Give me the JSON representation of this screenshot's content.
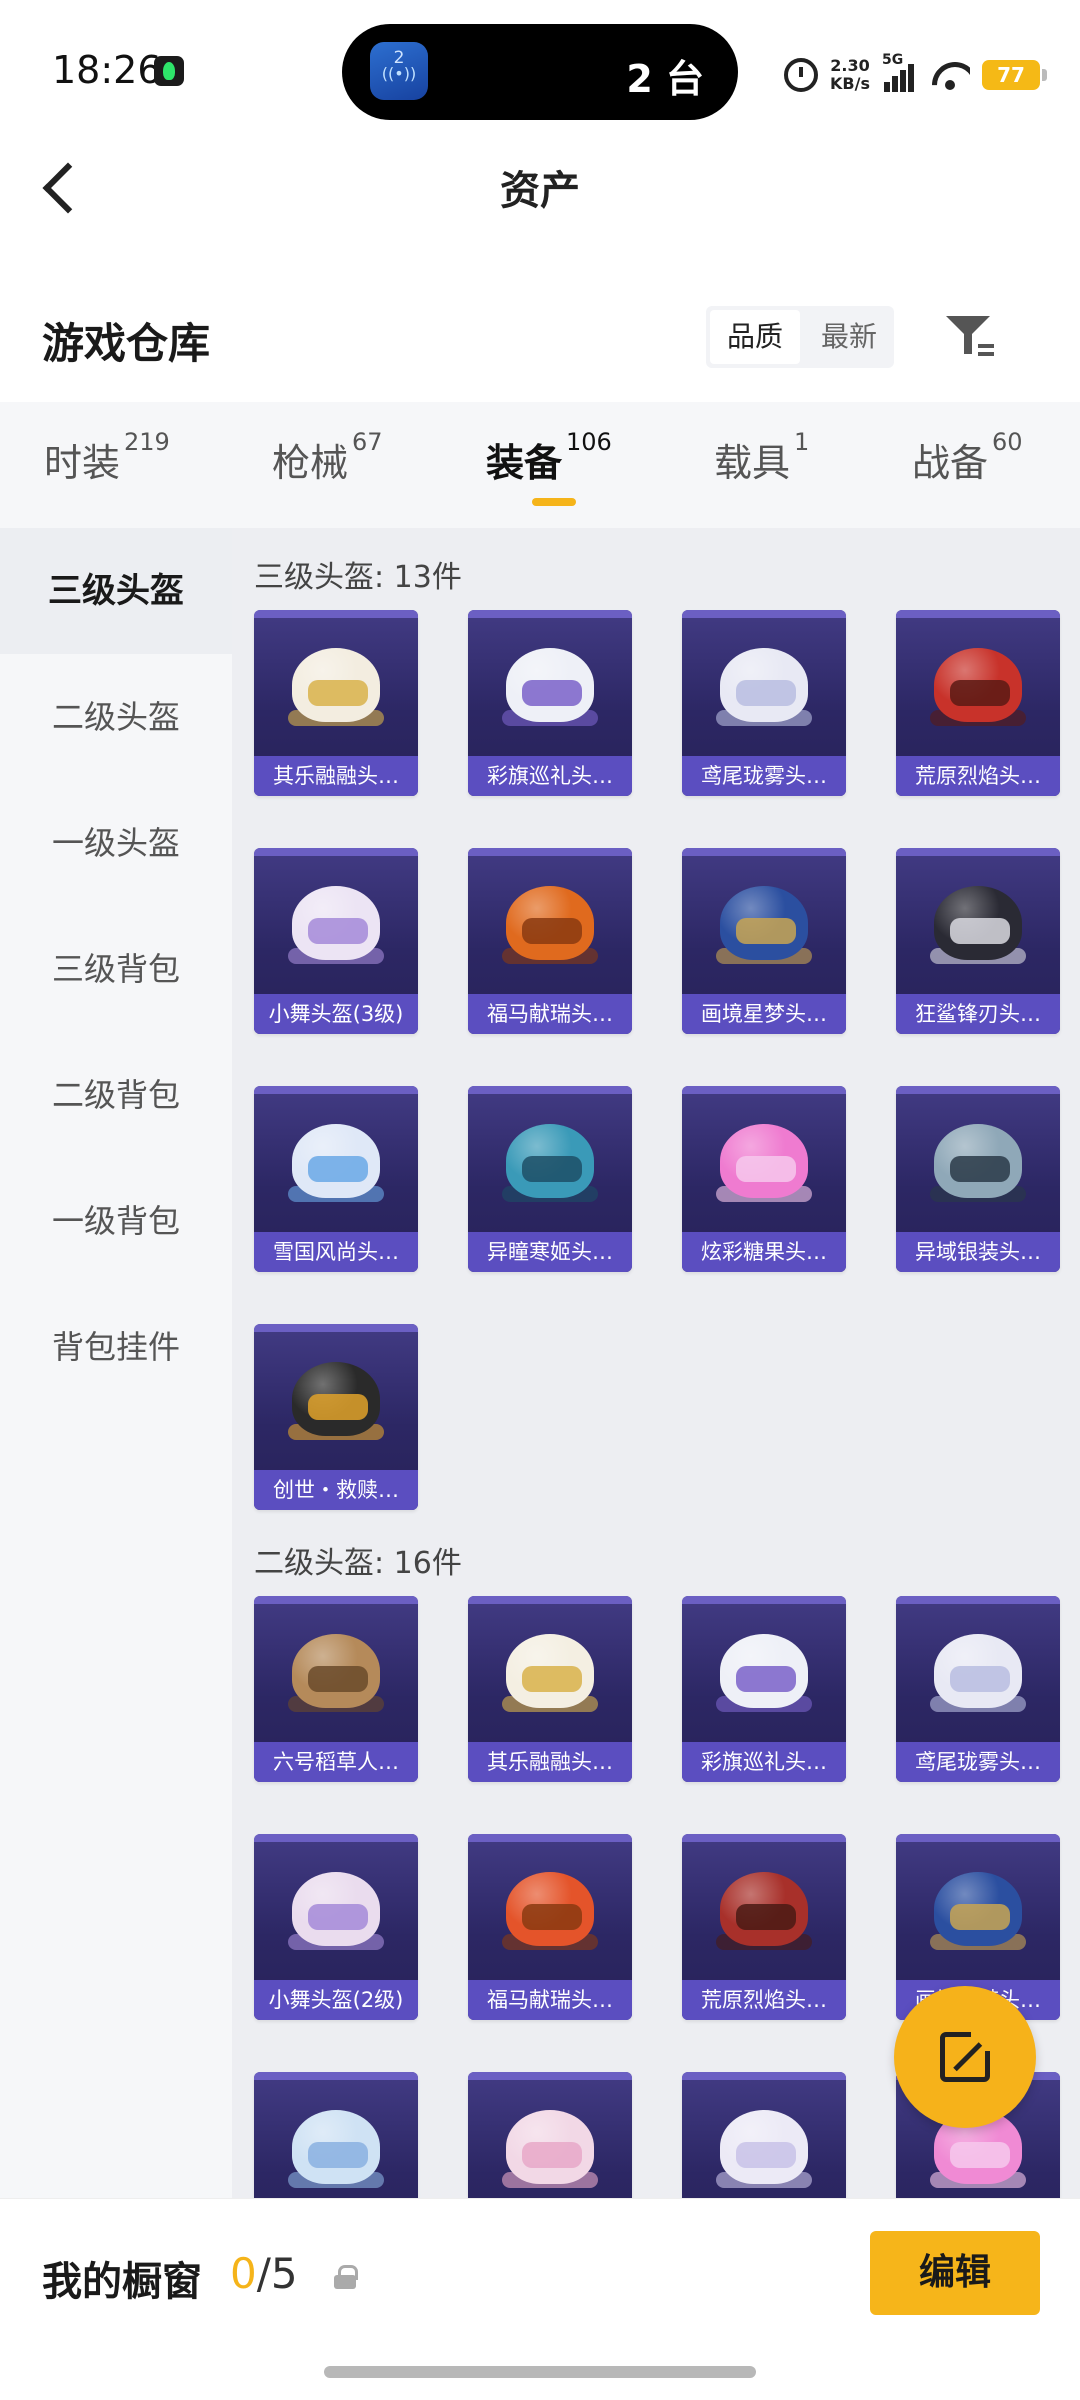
{
  "status_bar": {
    "time": "18:26",
    "island_badge": "2",
    "island_text": "2 台",
    "net_speed_value": "2.30",
    "net_speed_unit": "KB/s",
    "network_type": "5G",
    "battery": "77"
  },
  "header": {
    "title": "资产"
  },
  "section": {
    "title": "游戏仓库",
    "sort_options": [
      "品质",
      "最新"
    ],
    "sort_selected": "品质"
  },
  "tabs": [
    {
      "label": "时装",
      "count": "219"
    },
    {
      "label": "枪械",
      "count": "67"
    },
    {
      "label": "装备",
      "count": "106"
    },
    {
      "label": "载具",
      "count": "1"
    },
    {
      "label": "战备",
      "count": "60"
    }
  ],
  "active_tab": "装备",
  "sidebar": {
    "items": [
      "三级头盔",
      "二级头盔",
      "一级头盔",
      "三级背包",
      "二级背包",
      "一级背包",
      "背包挂件"
    ]
  },
  "groups": [
    {
      "title": "三级头盔: 13件",
      "items": [
        {
          "label": "其乐融融头…",
          "color": "#f3ede0",
          "accent": "#d8b24a"
        },
        {
          "label": "彩旗巡礼头…",
          "color": "#eef0f7",
          "accent": "#7a62c9"
        },
        {
          "label": "鸢尾珑雾头…",
          "color": "#e8e9f4",
          "accent": "#b8bde0"
        },
        {
          "label": "荒原烈焰头…",
          "color": "#c8322a",
          "accent": "#5a1a14"
        },
        {
          "label": "小舞头盔(3级)",
          "color": "#ece4f4",
          "accent": "#a58ad8"
        },
        {
          "label": "福马献瑞头…",
          "color": "#e06a1e",
          "accent": "#8a3a10"
        },
        {
          "label": "画境星梦头…",
          "color": "#2b4fa0",
          "accent": "#c8a452"
        },
        {
          "label": "狂鲨锋刃头…",
          "color": "#2a2a34",
          "accent": "#d9d9e0"
        },
        {
          "label": "雪国风尚头…",
          "color": "#dfe8f7",
          "accent": "#6aa8e6"
        },
        {
          "label": "异瞳寒姬头…",
          "color": "#3a9ab8",
          "accent": "#1d4f66"
        },
        {
          "label": "炫彩糖果头…",
          "color": "#ef7bd0",
          "accent": "#f6c8ec"
        },
        {
          "label": "异域银装头…",
          "color": "#8fa8b8",
          "accent": "#2a3a48"
        },
        {
          "label": "创世・救赎…",
          "color": "#2a2a2a",
          "accent": "#e0a22a"
        }
      ]
    },
    {
      "title": "二级头盔: 16件",
      "items": [
        {
          "label": "六号稻草人…",
          "color": "#b58a5a",
          "accent": "#6a4a2a"
        },
        {
          "label": "其乐融融头…",
          "color": "#f4efe2",
          "accent": "#d8b24a"
        },
        {
          "label": "彩旗巡礼头…",
          "color": "#eef0f7",
          "accent": "#7a62c9"
        },
        {
          "label": "鸢尾珑雾头…",
          "color": "#e8e9f4",
          "accent": "#b8bde0"
        },
        {
          "label": "小舞头盔(2级)",
          "color": "#eadcee",
          "accent": "#a58ad8"
        },
        {
          "label": "福马献瑞头…",
          "color": "#e4542a",
          "accent": "#8a3a10"
        },
        {
          "label": "荒原烈焰头…",
          "color": "#a8302a",
          "accent": "#4a1a14"
        },
        {
          "label": "画境星梦头…",
          "color": "#2b4fa0",
          "accent": "#c8a452"
        },
        {
          "label": "",
          "color": "#cfe2f4",
          "accent": "#8ab0e0"
        },
        {
          "label": "",
          "color": "#f2d8e6",
          "accent": "#e8a8c8"
        },
        {
          "label": "",
          "color": "#eceaf6",
          "accent": "#c8c2e8"
        },
        {
          "label": "",
          "color": "#f08ad4",
          "accent": "#f6c8ec"
        }
      ]
    }
  ],
  "bottom": {
    "showcase_label": "我的橱窗",
    "showcase_used": "0",
    "showcase_total": "/5",
    "edit_label": "编辑"
  }
}
